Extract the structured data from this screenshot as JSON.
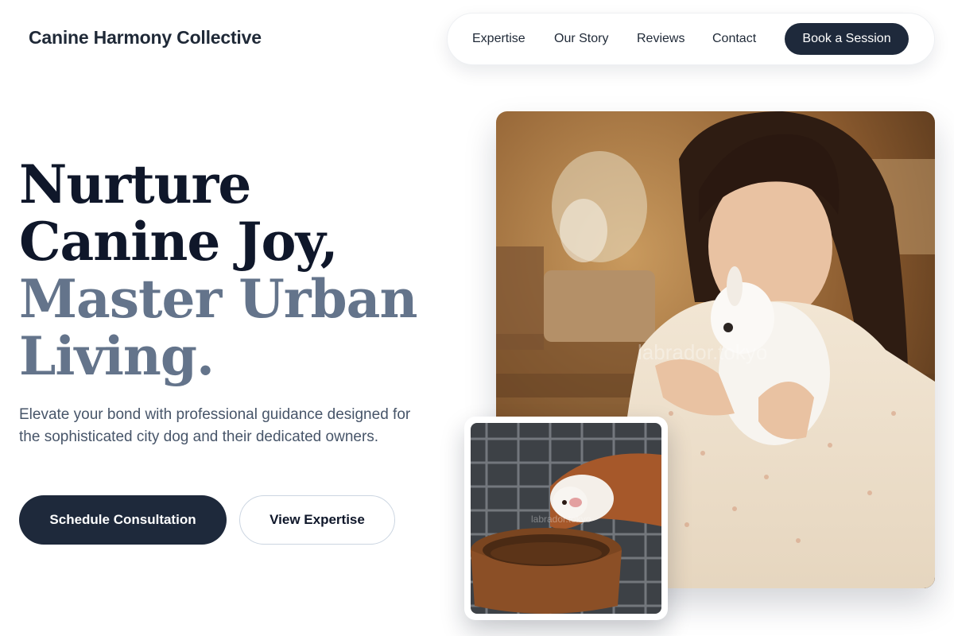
{
  "brand": {
    "name": "Canine Harmony Collective"
  },
  "nav": {
    "links": [
      "Expertise",
      "Our Story",
      "Reviews",
      "Contact"
    ],
    "cta": "Book a Session"
  },
  "hero": {
    "headline_line1": "Nurture Canine Joy,",
    "headline_line2": "Master Urban Living.",
    "subtext": "Elevate your bond with professional guidance designed for the sophisticated city dog and their dedicated owners.",
    "primary_button": "Schedule Consultation",
    "secondary_button": "View Expertise",
    "main_image_watermark": "labrador.tokyo",
    "thumb_image_watermark": "labrador.tokyo"
  },
  "colors": {
    "accent_dark": "#1e293b",
    "headline_dark": "#0f172a",
    "headline_muted": "#64748b"
  }
}
